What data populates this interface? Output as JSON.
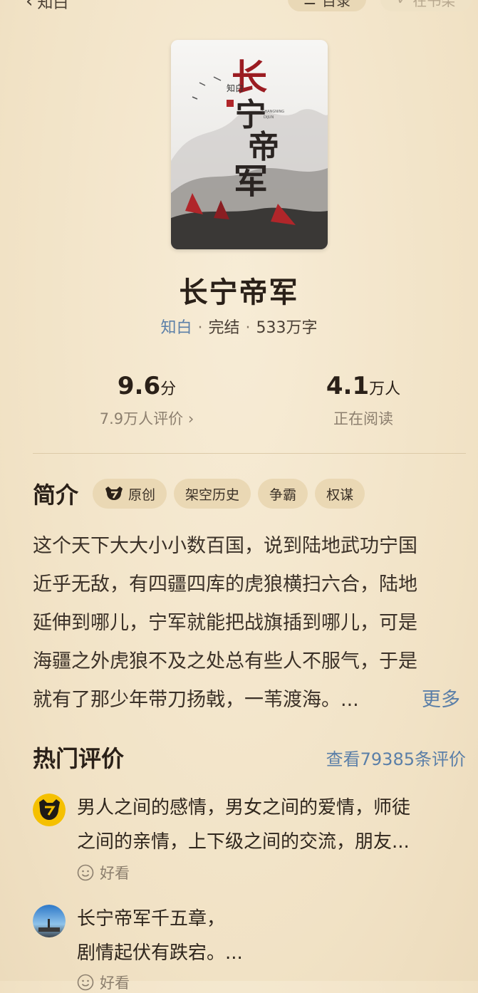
{
  "nav": {
    "back_label": "知白",
    "directory_label": "目录",
    "shelf_label": "在书架"
  },
  "book": {
    "title": "长宁帝军",
    "author": "知白",
    "status": "完结",
    "word_count": "533万字",
    "cover_text": "长宁帝军",
    "cover_author": "知白",
    "cover_pinyin_1": "CHANGNING",
    "cover_pinyin_2": "DIJUN"
  },
  "stats": {
    "score": "9.6",
    "score_unit": "分",
    "raters": "7.9万人评价",
    "readers": "4.1",
    "readers_unit": "万人",
    "readers_label": "正在阅读"
  },
  "intro": {
    "title": "简介",
    "tags": [
      "原创",
      "架空历史",
      "争霸",
      "权谋"
    ],
    "lines": [
      "这个天下大大小小数百国，说到陆地武功宁国",
      "近乎无敌，有四疆四库的虎狼横扫六合，陆地",
      "延伸到哪儿，宁军就能把战旗插到哪儿，可是",
      "海疆之外虎狼不及之处总有些人不服气，于是",
      "就有了那少年带刀扬戟，一苇渡海。..."
    ],
    "more_label": "更多"
  },
  "hot_reviews": {
    "title": "热门评价",
    "view_all": "查看79385条评价",
    "items": [
      {
        "line1": "男人之间的感情，男女之间的爱情，师徒",
        "line2": "之间的亲情，上下级之间的交流，朋友...",
        "reaction": "好看"
      },
      {
        "line1": "长宁帝军千五章，",
        "line2": "剧情起伏有跌宕。...",
        "reaction": "好看"
      }
    ]
  },
  "colors": {
    "background": "#f4e7cd",
    "link_blue": "#5b7fa8",
    "tag_bg": "#ead8b4",
    "text_dark": "#2a2018",
    "text_muted": "#8c7f6e"
  }
}
